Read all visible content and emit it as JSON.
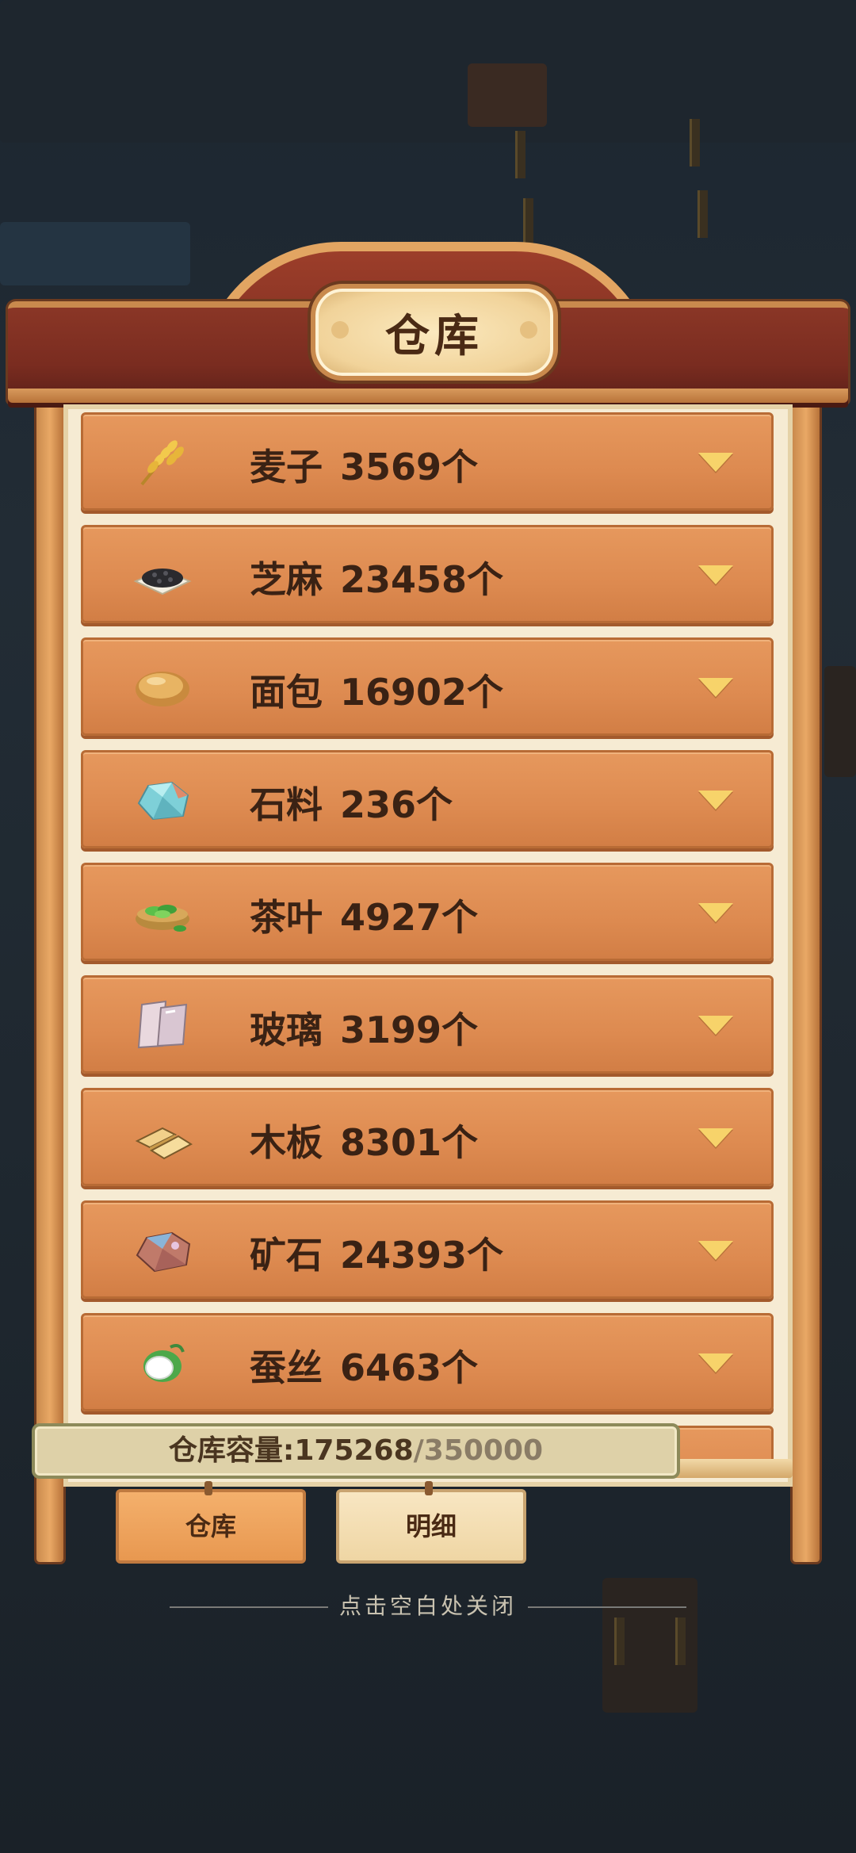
{
  "title": "仓库",
  "items": [
    {
      "name": "麦子",
      "count": "3569个",
      "icon": "wheat-icon"
    },
    {
      "name": "芝麻",
      "count": "23458个",
      "icon": "sesame-icon"
    },
    {
      "name": "面包",
      "count": "16902个",
      "icon": "bread-icon"
    },
    {
      "name": "石料",
      "count": "236个",
      "icon": "stone-icon"
    },
    {
      "name": "茶叶",
      "count": "4927个",
      "icon": "tea-icon"
    },
    {
      "name": "玻璃",
      "count": "3199个",
      "icon": "glass-icon"
    },
    {
      "name": "木板",
      "count": "8301个",
      "icon": "plank-icon"
    },
    {
      "name": "矿石",
      "count": "24393个",
      "icon": "ore-icon"
    },
    {
      "name": "蚕丝",
      "count": "6463个",
      "icon": "silk-icon"
    }
  ],
  "capacity": {
    "label": "仓库容量:",
    "used": "175268",
    "total": "/350000"
  },
  "tabs": {
    "warehouse": "仓库",
    "details": "明细"
  },
  "close_hint": "点击空白处关闭",
  "colors": {
    "item_bg": "#dd8a50",
    "arrow": "#f7d36a",
    "panel": "#f6ebd3",
    "roof": "#7a2c20"
  }
}
